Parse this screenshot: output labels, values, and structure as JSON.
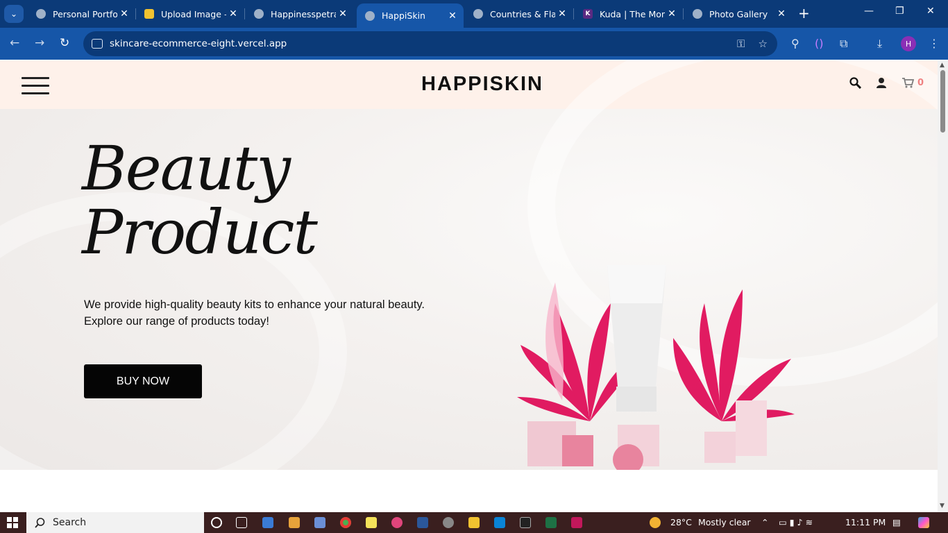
{
  "browser": {
    "tabs": [
      {
        "title": "Personal Portfoli",
        "active": false
      },
      {
        "title": "Upload Image –",
        "active": false
      },
      {
        "title": "Happinesspetra/",
        "active": false
      },
      {
        "title": "HappiSkin",
        "active": true
      },
      {
        "title": "Countries & Flag",
        "active": false
      },
      {
        "title": "Kuda | The Mon",
        "active": false
      },
      {
        "title": "Photo Gallery",
        "active": false
      }
    ],
    "url": "skincare-ecommerce-eight.vercel.app",
    "profile_initial": "H"
  },
  "site": {
    "brand": "HAPPISKIN",
    "cart_count": "0",
    "hero": {
      "title_line1": "Beauty",
      "title_line2": "Product",
      "description": "We provide high-quality beauty kits to enhance your natural beauty. Explore our range of products today!",
      "cta": "BUY NOW"
    }
  },
  "taskbar": {
    "search_label": "Search",
    "weather_temp": "28°C",
    "weather_text": "Mostly clear",
    "time": "11:11 PM"
  },
  "colors": {
    "tab_bar": "#0b3a78",
    "toolbar": "#1656a8",
    "header_bg": "#fef1ea",
    "button_bg": "#050505",
    "cart_count": "#e21b1b",
    "accent_pink": "#e0105a"
  }
}
